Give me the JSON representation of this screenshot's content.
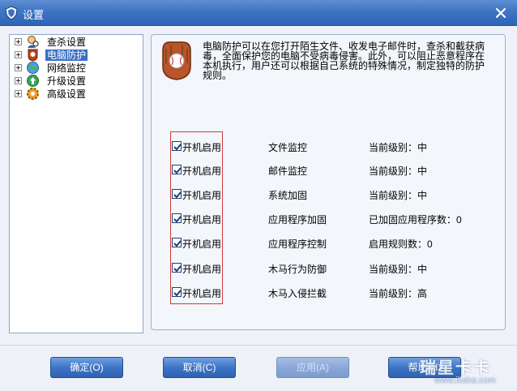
{
  "window": {
    "title": "设置"
  },
  "tree": {
    "items": [
      {
        "label": "查杀设置",
        "icon": "magnifier-person-icon"
      },
      {
        "label": "电脑防护",
        "icon": "glove-shield-icon",
        "selected": true
      },
      {
        "label": "网络监控",
        "icon": "globe-icon"
      },
      {
        "label": "升级设置",
        "icon": "update-arrow-icon"
      },
      {
        "label": "高级设置",
        "icon": "gear-icon"
      }
    ]
  },
  "panel": {
    "description": "电脑防护可以在您打开陌生文件、收发电子邮件时，查杀和截获病毒，全面保护您的电脑不受病毒侵害。此外，可以阻止恶意程序在本机执行，用户还可以根据自己系统的特殊情况，制定独特的防护规则。",
    "rows": [
      {
        "checkbox_label": "开机启用",
        "checked": true,
        "feature": "文件监控",
        "status": "当前级别：中"
      },
      {
        "checkbox_label": "开机启用",
        "checked": true,
        "feature": "邮件监控",
        "status": "当前级别：中"
      },
      {
        "checkbox_label": "开机启用",
        "checked": true,
        "feature": "系统加固",
        "status": "当前级别：中"
      },
      {
        "checkbox_label": "开机启用",
        "checked": true,
        "feature": "应用程序加固",
        "status": "已加固应用程序数：0"
      },
      {
        "checkbox_label": "开机启用",
        "checked": true,
        "feature": "应用程序控制",
        "status": "启用规则数：0"
      },
      {
        "checkbox_label": "开机启用",
        "checked": true,
        "feature": "木马行为防御",
        "status": "当前级别：中"
      },
      {
        "checkbox_label": "开机启用",
        "checked": true,
        "feature": "木马入侵拦截",
        "status": "当前级别：高"
      }
    ]
  },
  "buttons": {
    "ok": "确定(O)",
    "cancel": "取消(C)",
    "apply": "应用(A)",
    "help": "帮助(H)"
  },
  "watermark": {
    "brand": "瑞星卡卡",
    "url": "www.ikaka.com"
  },
  "colors": {
    "titlebar": "#3f74c4",
    "button": "#3e74c7",
    "selection": "#3a6fc6",
    "highlight_box": "#d23a3a"
  }
}
